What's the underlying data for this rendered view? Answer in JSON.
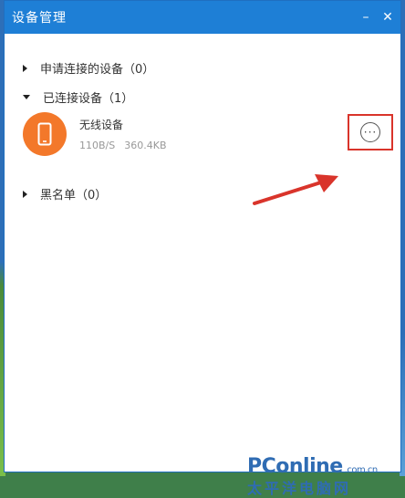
{
  "window": {
    "title": "设备管理",
    "minimize_glyph": "–",
    "close_glyph": "✕"
  },
  "sections": {
    "requested": "申请连接的设备（0）",
    "connected": "已连接设备（1）",
    "blacklist": "黑名单（0）"
  },
  "device": {
    "name": "无线设备",
    "speed": "110B/S",
    "size": "360.4KB",
    "icon": "phone-icon",
    "avatar_color": "#f3782a"
  },
  "more_button": {
    "glyph": "···",
    "highlight_color": "#d9342b"
  },
  "watermark": {
    "brand": "PConline",
    "domain": ".com.cn",
    "cn_name": "太平洋电脑网"
  },
  "colors": {
    "titlebar": "#1e7fd6",
    "accent_arrow": "#d9342b",
    "logo": "#2f6cb3"
  }
}
